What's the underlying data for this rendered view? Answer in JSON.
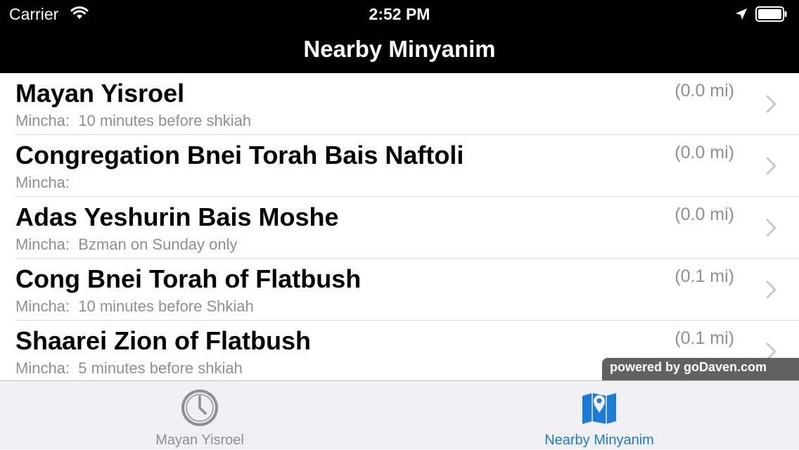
{
  "status_bar": {
    "carrier": "Carrier",
    "time": "2:52 PM",
    "wifi_icon": "wifi-icon",
    "location_icon": "location-arrow-icon",
    "battery_icon": "battery-icon"
  },
  "nav": {
    "title": "Nearby Minyanim"
  },
  "list": {
    "items": [
      {
        "name": "Mayan Yisroel",
        "detail": "Mincha:  10 minutes before shkiah",
        "distance": "(0.0 mi)"
      },
      {
        "name": "Congregation Bnei Torah Bais Naftoli",
        "detail": "Mincha:",
        "distance": "(0.0 mi)"
      },
      {
        "name": "Adas Yeshurin Bais Moshe",
        "detail": "Mincha:  Bzman on Sunday only",
        "distance": "(0.0 mi)"
      },
      {
        "name": "Cong Bnei Torah of Flatbush",
        "detail": "Mincha:  10 minutes before Shkiah",
        "distance": "(0.1 mi)"
      },
      {
        "name": "Shaarei Zion of Flatbush",
        "detail": "Mincha:  5 minutes before shkiah",
        "distance": "(0.1 mi)"
      }
    ]
  },
  "badge": {
    "text": "powered by goDaven.com"
  },
  "tabs": [
    {
      "label": "Mayan Yisroel",
      "icon": "clock-icon",
      "active": false
    },
    {
      "label": "Nearby Minyanim",
      "icon": "map-pin-icon",
      "active": true
    }
  ],
  "colors": {
    "accent": "#1a7bd8",
    "inactive_tab": "#8e8e93",
    "secondary_text": "#8e8e93"
  }
}
